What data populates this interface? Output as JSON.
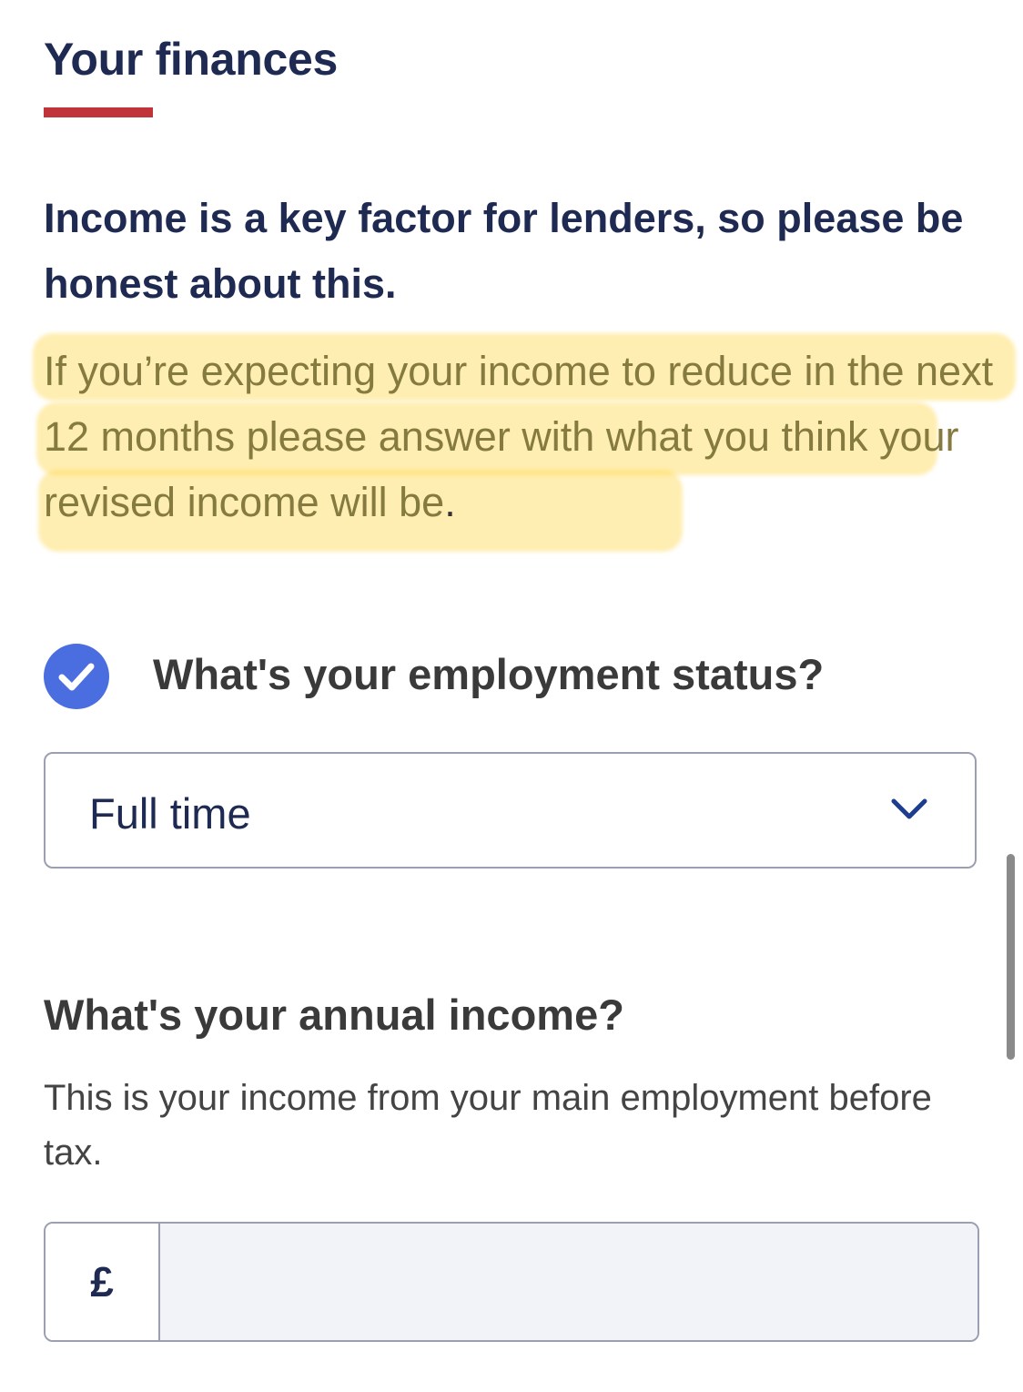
{
  "section": {
    "title": "Your finances",
    "accent_color": "#c03339"
  },
  "intro": {
    "lead": "Income is a key factor for lenders, so please be honest about this.",
    "highlighted_text": "If you’re expecting your income to reduce in the next 12 months please answer with what you think your revised income will be",
    "trailing": "."
  },
  "employment": {
    "icon": "check-circle-icon",
    "label": "What's your employment status?",
    "selected_value": "Full time",
    "dropdown_icon": "chevron-down-icon"
  },
  "income": {
    "label": "What's your annual income?",
    "hint": "This is your income from your main employment before tax.",
    "currency_prefix": "£",
    "value": ""
  },
  "colors": {
    "heading": "#1f2a52",
    "check": "#4a6ee0",
    "highlight": "#ffd746"
  }
}
